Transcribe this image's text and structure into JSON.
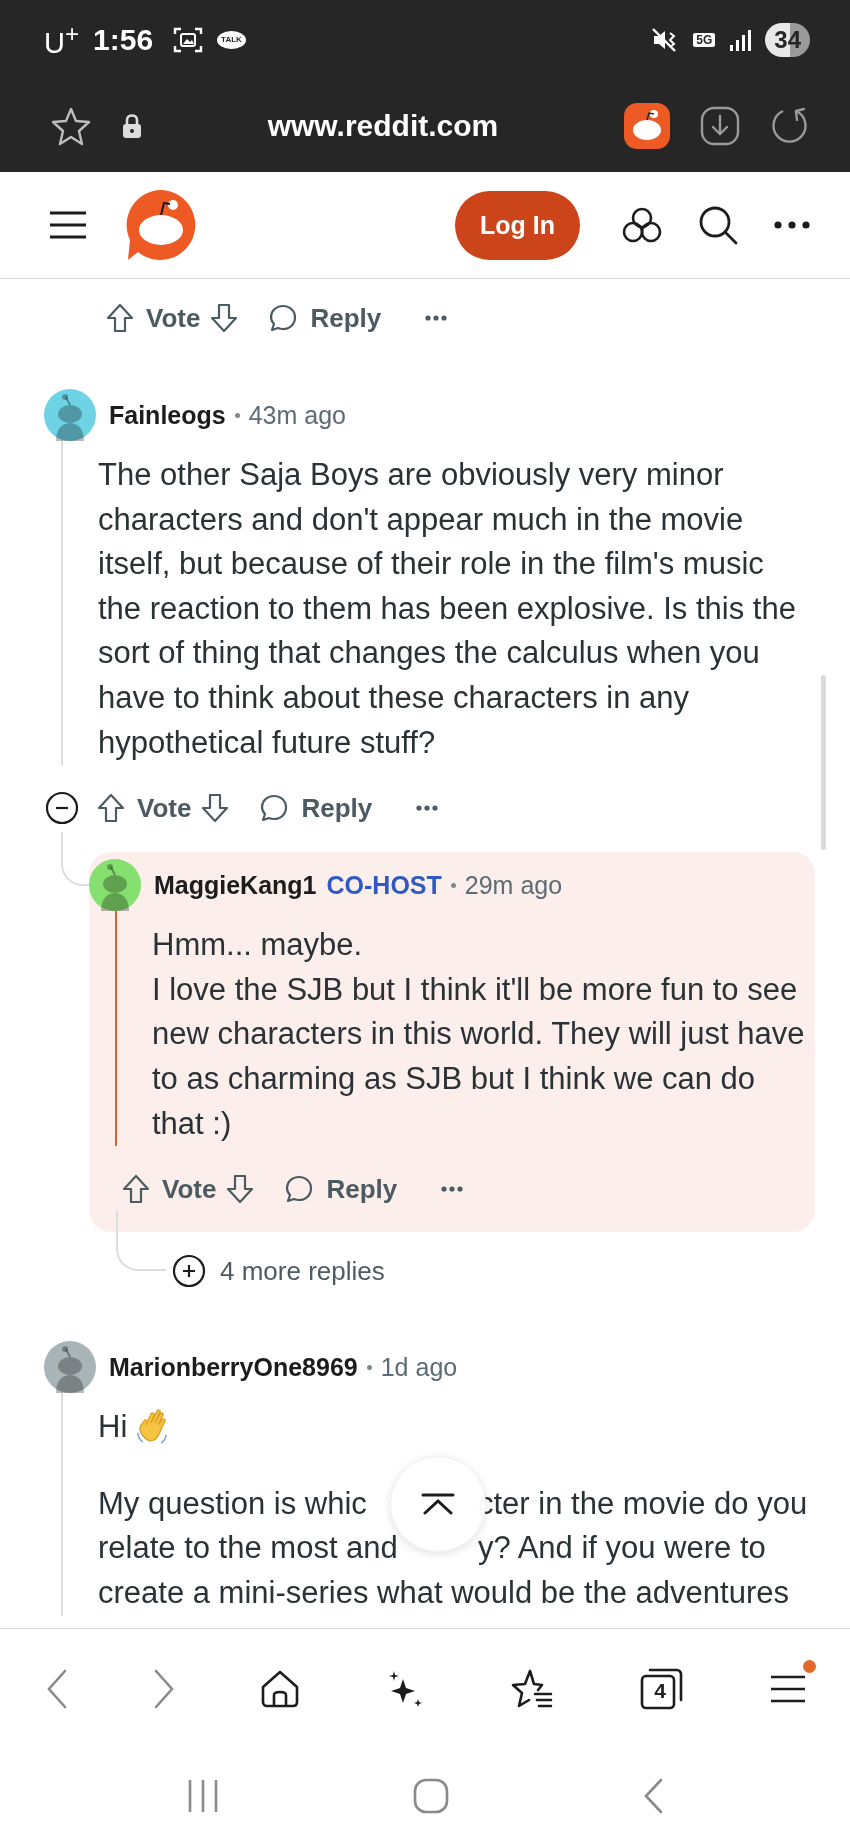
{
  "status_bar": {
    "carrier": "U$^{+}$",
    "time": "1:56",
    "chat_badge": "TALK",
    "network": "5G",
    "battery": "34"
  },
  "browser": {
    "url": "www.reddit.com",
    "bookmarked": false
  },
  "site_header": {
    "login_button": "Log In"
  },
  "top_actions": {
    "vote": "Vote",
    "reply": "Reply"
  },
  "comments": [
    {
      "author": "Fainleogs",
      "time": "43m ago",
      "color": "#6fd3e6",
      "body": [
        {
          "kind": "text",
          "text": "The other Saja Boys are obviously very minor characters and don't appear much in the movie itself, but because of their role in the film's music the reaction to them has been explosive. Is this the sort of thing that changes the calculus when you have to think about these characters in any hypothetical future stuff?"
        }
      ],
      "actions": {
        "vote": "Vote",
        "reply": "Reply"
      },
      "replies": [
        {
          "author": "MaggieKang1",
          "flair": "CO-HOST",
          "time": "29m ago",
          "color": "#86e070",
          "highlighted": true,
          "body": [
            {
              "kind": "text",
              "text": "Hmm... maybe."
            },
            {
              "kind": "text",
              "text": "I love the SJB but I think it'll be more fun to see new characters in this world. They will just have to as charming as SJB but I think we can do that :)"
            }
          ],
          "actions": {
            "vote": "Vote",
            "reply": "Reply"
          }
        }
      ],
      "more_replies": "4 more replies"
    },
    {
      "author": "MarionberryOne8969",
      "time": "1d ago",
      "color": "#a9b4b8",
      "body": [
        {
          "kind": "wave",
          "text": "Hi"
        },
        {
          "kind": "split",
          "segments": [
            "My question is whic",
            "cter in the movie do you"
          ],
          "scroll_top": true
        },
        {
          "kind": "split",
          "segments": [
            "relate to the most and",
            "y? And if you were to"
          ]
        },
        {
          "kind": "text",
          "text": "create a mini-series what would be the adventures"
        }
      ]
    }
  ],
  "bottom_nav": {
    "tab_count": "4",
    "menu_notification": true
  }
}
